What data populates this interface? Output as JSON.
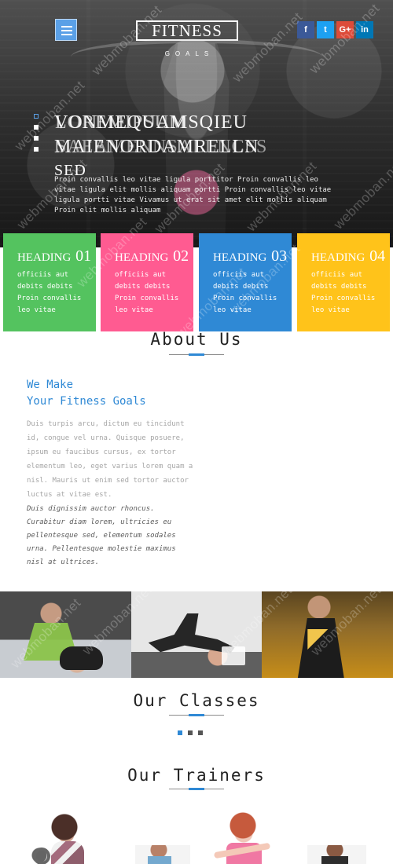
{
  "hero": {
    "menu_icon": "hamburger-menu-icon",
    "brand": {
      "title": "FITNESS",
      "subtitle": "GOALS"
    },
    "social_links": [
      {
        "label": "f",
        "icon": "facebook-icon",
        "color": "#3b5998"
      },
      {
        "label": "t",
        "icon": "twitter-icon",
        "color": "#1da1f2"
      },
      {
        "label": "G+",
        "icon": "google-plus-icon",
        "color": "#dd4b39"
      },
      {
        "label": "in",
        "icon": "linkedin-icon",
        "color": "#0077b5"
      }
    ],
    "slide_indicators": [
      {
        "active": true
      },
      {
        "active": false
      },
      {
        "active": false
      },
      {
        "active": false
      }
    ],
    "overlay_lines": [
      {
        "text": "VONMEQUAMSQIEU"
      },
      {
        "text": "LOREMIPSUM"
      },
      {
        "text": "MAIENORDAMRELLN"
      },
      {
        "text": "SAEAMENNSALLNCSS"
      }
    ],
    "subline": "SED",
    "paragraph": "Proin convallis leo vitae ligula porttitor Proin convallis leo vitae ligula elit mollis aliquam portti Proin convallis leo vitae ligula portti vitae Vivamus ut erat sit amet elit mollis aliquam Proin elit mollis aliquam"
  },
  "features": [
    {
      "title": "HEADING",
      "number": "01",
      "text": "officiis aut debits debits Proin convallis leo vitae",
      "color": "#54c35f"
    },
    {
      "title": "HEADING",
      "number": "02",
      "text": "officiis aut debits debits Proin convallis leo vitae",
      "color": "#ff5b91"
    },
    {
      "title": "HEADING",
      "number": "03",
      "text": "officiis aut debits debits Proin convallis leo vitae",
      "color": "#2f89d5"
    },
    {
      "title": "HEADING",
      "number": "04",
      "text": "officiis aut debits debits Proin convallis leo vitae",
      "color": "#ffc31a"
    }
  ],
  "about": {
    "title": "About Us",
    "headline_line1": "We Make",
    "headline_line2": "Your Fitness Goals",
    "body": "Duis turpis arcu, dictum eu tincidunt id, congue vel urna. Quisque posuere, ipsum eu faucibus cursus, ex tortor elementum leo, eget varius lorem quam a nisl. Mauris ut enim sed tortor auctor luctus at vitae est.",
    "quote": "Duis dignissim auctor rhoncus. Curabitur diam lorem, ultricies eu pellentesque sed, elementum sodales urna. Pellentesque molestie maximus nisl at ultrices."
  },
  "classes": {
    "title": "Our Classes",
    "dots": [
      {
        "active": true
      },
      {
        "active": false
      },
      {
        "active": false
      }
    ]
  },
  "trainers": {
    "title": "Our Trainers"
  },
  "watermark": {
    "text": "webmoban.net"
  }
}
